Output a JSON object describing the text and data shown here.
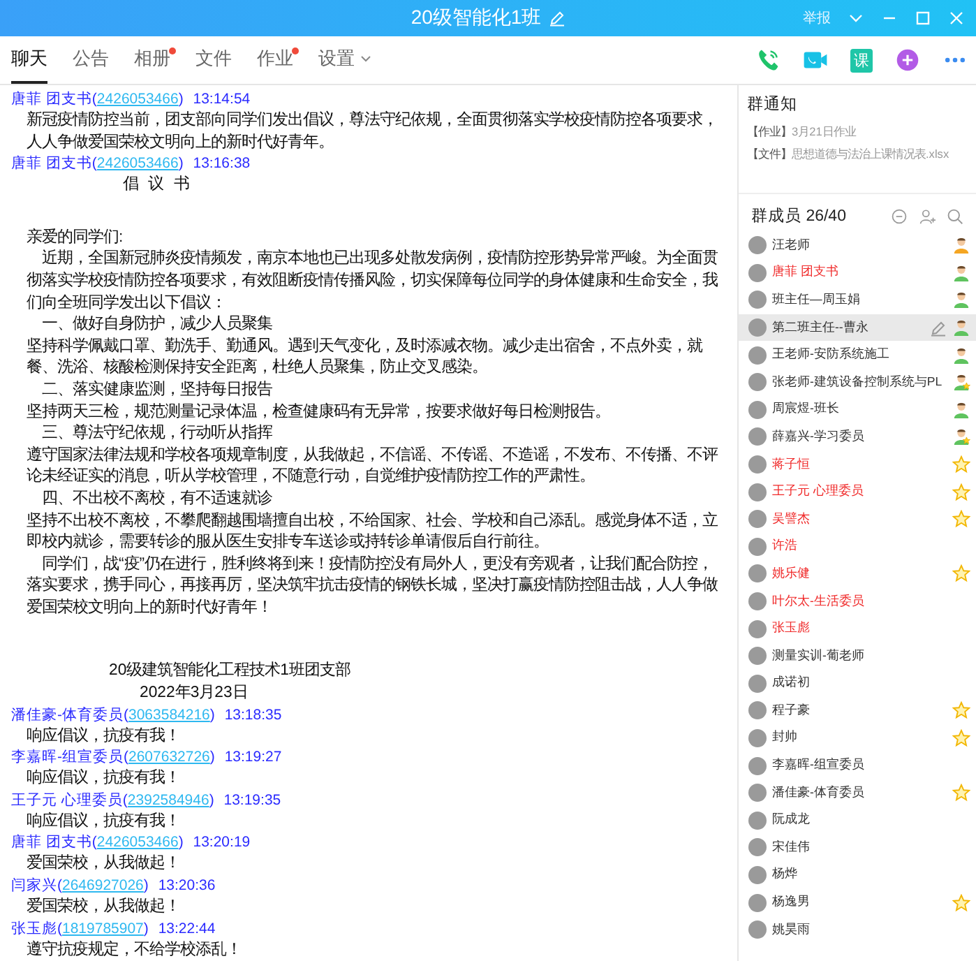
{
  "window": {
    "title": "20级智能化1班",
    "report": "举报"
  },
  "tabs": [
    {
      "label": "聊天",
      "selected": true,
      "badge": false,
      "dropdown": false
    },
    {
      "label": "公告",
      "selected": false,
      "badge": false,
      "dropdown": false
    },
    {
      "label": "相册",
      "selected": false,
      "badge": true,
      "dropdown": false
    },
    {
      "label": "文件",
      "selected": false,
      "badge": false,
      "dropdown": false
    },
    {
      "label": "作业",
      "selected": false,
      "badge": true,
      "dropdown": false
    },
    {
      "label": "设置",
      "selected": false,
      "badge": false,
      "dropdown": true
    }
  ],
  "toolbar": {
    "class_button": "课"
  },
  "messages": [
    {
      "sender": "唐菲  团支书",
      "qq": "(2426053466)",
      "time": "13:14:54",
      "lines": [
        {
          "kind": "plain",
          "text": "新冠疫情防控当前，团支部向同学们发出倡议，尊法守纪依规，全面贯彻落实学校疫情防控各项要求，人人争做爱国荣校文明向上的新时代好青年。"
        }
      ]
    },
    {
      "sender": "唐菲  团支书",
      "qq": "(2426053466)",
      "time": "13:16:38",
      "lines": [
        {
          "kind": "title",
          "text": "倡 议 书"
        },
        {
          "kind": "plain",
          "text": "亲爱的同学们:"
        },
        {
          "kind": "lead",
          "text": "近期，全国新冠肺炎疫情频发，南京本地也已出现多处散发病例，疫情防控形势异常严峻。为全面贯彻落实学校疫情防控各项要求，有效阻断疫情传播风险，切实保障每位同学的身体健康和生命安全，我们向全班同学发出以下倡议："
        },
        {
          "kind": "lead",
          "text": "一、做好自身防护，减少人员聚集"
        },
        {
          "kind": "plain",
          "text": "坚持科学佩戴口罩、勤洗手、勤通风。遇到天气变化，及时添减衣物。减少走出宿舍，不点外卖，就餐、洗浴、核酸检测保持安全距离，杜绝人员聚集，防止交叉感染。"
        },
        {
          "kind": "lead",
          "text": "二、落实健康监测，坚持每日报告"
        },
        {
          "kind": "plain",
          "text": "坚持两天三检，规范测量记录体温，检查健康码有无异常，按要求做好每日检测报告。"
        },
        {
          "kind": "lead",
          "text": "三、尊法守纪依规，行动听从指挥"
        },
        {
          "kind": "plain",
          "text": "遵守国家法律法规和学校各项规章制度，从我做起，不信谣、不传谣、不造谣，不发布、不传播、不评论未经证实的消息，听从学校管理，不随意行动，自觉维护疫情防控工作的严肃性。"
        },
        {
          "kind": "lead",
          "text": "四、不出校不离校，有不适速就诊"
        },
        {
          "kind": "plain",
          "text": "坚持不出校不离校，不攀爬翻越围墙擅自出校，不给国家、社会、学校和自己添乱。感觉身体不适，立即校内就诊，需要转诊的服从医生安排专车送诊或持转诊单请假后自行前往。"
        },
        {
          "kind": "lead",
          "text": "同学们，战“疫”仍在进行，胜利终将到来！疫情防控没有局外人，更没有旁观者，让我们配合防控，落实要求，携手同心，再接再厉，坚决筑牢抗击疫情的钢铁长城，坚决打赢疫情防控阻击战，人人争做爱国荣校文明向上的新时代好青年！"
        },
        {
          "kind": "sign",
          "text": "20级建筑智能化工程技术1班团支部"
        },
        {
          "kind": "date",
          "text": "2022年3月23日"
        }
      ]
    },
    {
      "sender": "潘佳豪-体育委员",
      "qq": "(3063584216)",
      "time": "13:18:35",
      "lines": [
        {
          "kind": "plain",
          "text": "响应倡议，抗疫有我！"
        }
      ]
    },
    {
      "sender": "李嘉晖-组宣委员",
      "qq": "(2607632726)",
      "time": "13:19:27",
      "lines": [
        {
          "kind": "plain",
          "text": "响应倡议，抗疫有我！"
        }
      ]
    },
    {
      "sender": "王子元  心理委员",
      "qq": "(2392584946)",
      "time": "13:19:35",
      "lines": [
        {
          "kind": "plain",
          "text": "响应倡议，抗疫有我！"
        }
      ]
    },
    {
      "sender": "唐菲  团支书",
      "qq": "(2426053466)",
      "time": "13:20:19",
      "lines": [
        {
          "kind": "plain",
          "text": "爱国荣校，从我做起！"
        }
      ]
    },
    {
      "sender": "闫家兴",
      "qq": "(2646927026)",
      "time": "13:20:36",
      "lines": [
        {
          "kind": "plain",
          "text": "爱国荣校，从我做起！"
        }
      ]
    },
    {
      "sender": "张玉彪",
      "qq": "(1819785907)",
      "time": "13:22:44",
      "lines": [
        {
          "kind": "plain",
          "text": "遵守抗疫规定，不给学校添乱！"
        }
      ]
    }
  ],
  "notice": {
    "title": "群通知",
    "items": [
      {
        "tag": "【作业】",
        "text": "3月21日作业"
      },
      {
        "tag": "【文件】",
        "text": "思想道德与法治上课情况表.xlsx"
      }
    ]
  },
  "members": {
    "title": "群成员 26/40",
    "list": [
      {
        "name": "汪老师",
        "highlighted": false,
        "selected": false,
        "kind": "owner"
      },
      {
        "name": "唐菲  团支书",
        "highlighted": true,
        "selected": false,
        "kind": "admin"
      },
      {
        "name": "班主任—周玉娟",
        "highlighted": false,
        "selected": false,
        "kind": "admin"
      },
      {
        "name": "第二班主任--曹永",
        "highlighted": false,
        "selected": true,
        "kind": "admin"
      },
      {
        "name": "王老师-安防系统施工",
        "highlighted": false,
        "selected": false,
        "kind": "admin"
      },
      {
        "name": "张老师-建筑设备控制系统与PL",
        "highlighted": false,
        "selected": false,
        "kind": "adminstar"
      },
      {
        "name": "周宸煜-班长",
        "highlighted": false,
        "selected": false,
        "kind": "admin"
      },
      {
        "name": "薛嘉兴-学习委员",
        "highlighted": false,
        "selected": false,
        "kind": "adminstar"
      },
      {
        "name": "蒋子恒",
        "highlighted": true,
        "selected": false,
        "kind": "star"
      },
      {
        "name": "王子元  心理委员",
        "highlighted": true,
        "selected": false,
        "kind": "star"
      },
      {
        "name": "吴譬杰",
        "highlighted": true,
        "selected": false,
        "kind": "star"
      },
      {
        "name": "许浩",
        "highlighted": true,
        "selected": false,
        "kind": "member"
      },
      {
        "name": "姚乐健",
        "highlighted": true,
        "selected": false,
        "kind": "star"
      },
      {
        "name": "叶尔太-生活委员",
        "highlighted": true,
        "selected": false,
        "kind": "member"
      },
      {
        "name": "张玉彪",
        "highlighted": true,
        "selected": false,
        "kind": "member"
      },
      {
        "name": "测量实训-葡老师",
        "highlighted": false,
        "selected": false,
        "kind": "member"
      },
      {
        "name": "成诺初",
        "highlighted": false,
        "selected": false,
        "kind": "member"
      },
      {
        "name": "程子豪",
        "highlighted": false,
        "selected": false,
        "kind": "star"
      },
      {
        "name": "封帅",
        "highlighted": false,
        "selected": false,
        "kind": "star"
      },
      {
        "name": "李嘉晖-组宣委员",
        "highlighted": false,
        "selected": false,
        "kind": "member"
      },
      {
        "name": "潘佳豪-体育委员",
        "highlighted": false,
        "selected": false,
        "kind": "star"
      },
      {
        "name": "阮成龙",
        "highlighted": false,
        "selected": false,
        "kind": "member"
      },
      {
        "name": "宋佳伟",
        "highlighted": false,
        "selected": false,
        "kind": "member"
      },
      {
        "name": "杨烨",
        "highlighted": false,
        "selected": false,
        "kind": "member"
      },
      {
        "name": "杨逸男",
        "highlighted": false,
        "selected": false,
        "kind": "star"
      },
      {
        "name": "姚昊雨",
        "highlighted": false,
        "selected": false,
        "kind": "member"
      }
    ]
  }
}
